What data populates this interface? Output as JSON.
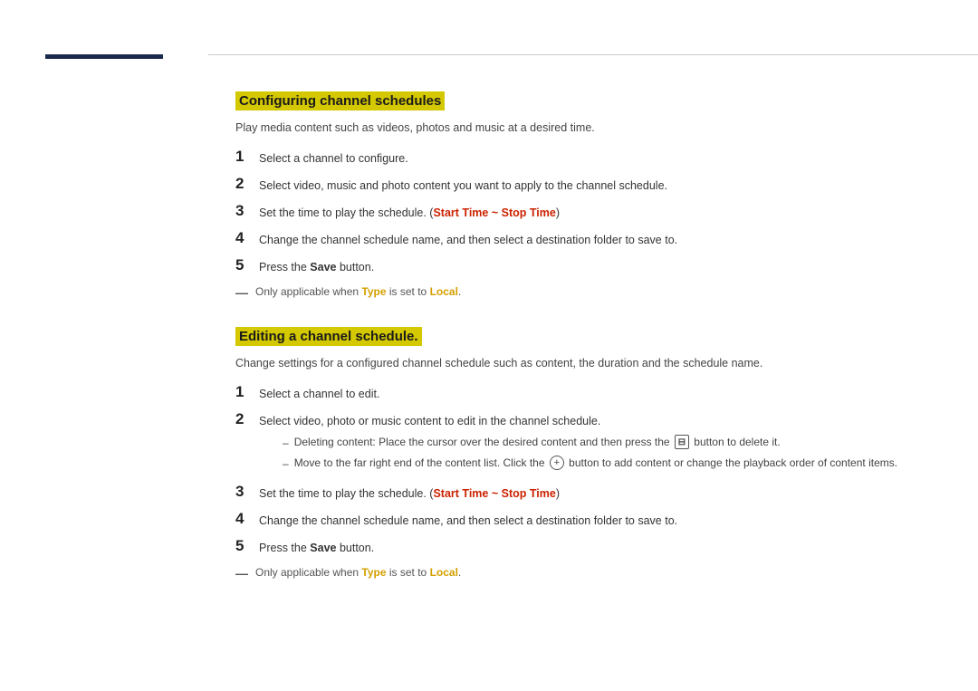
{
  "sidebar": {
    "bar": ""
  },
  "section1": {
    "title": "Configuring channel schedules",
    "subtitle": "Play media content such as videos, photos and music at a desired time.",
    "steps": [
      {
        "number": "1",
        "text": "Select a channel to configure."
      },
      {
        "number": "2",
        "text": "Select video, music and photo content you want to apply to the channel schedule."
      },
      {
        "number": "3",
        "text_before": "Set the time to play the schedule. (",
        "highlight": "Start Time ~ Stop Time",
        "text_after": ")"
      },
      {
        "number": "4",
        "text": "Change the channel schedule name, and then select a destination folder to save to."
      },
      {
        "number": "5",
        "text_before": "Press the ",
        "bold": "Save",
        "text_after": " button."
      }
    ],
    "note": "Only applicable when ",
    "note_bold": "Type",
    "note_mid": " is set to ",
    "note_end": "Local",
    "note_end_dot": "."
  },
  "section2": {
    "title": "Editing a channel schedule.",
    "subtitle": "Change settings for a configured channel schedule such as content, the duration and the schedule name.",
    "steps": [
      {
        "number": "1",
        "text": "Select a channel to edit."
      },
      {
        "number": "2",
        "text": "Select video, photo or music content to edit in the channel schedule."
      },
      {
        "number": "3",
        "text_before": "Set the time to play the schedule. (",
        "highlight": "Start Time ~ Stop Time",
        "text_after": ")"
      },
      {
        "number": "4",
        "text": "Change the channel schedule name, and then select a destination folder to save to."
      },
      {
        "number": "5",
        "text_before": "Press the ",
        "bold": "Save",
        "text_after": " button."
      }
    ],
    "sub_bullets": [
      {
        "text_before": "Deleting content: Place the cursor over the desired content and then press the ",
        "icon": "delete",
        "text_after": " button to delete it."
      },
      {
        "text_before": "Move to the far right end of the content list. Click the ",
        "icon": "plus",
        "text_after": " button to add content or change the playback order of content items."
      }
    ],
    "note": "Only applicable when ",
    "note_bold": "Type",
    "note_mid": " is set to ",
    "note_end": "Local",
    "note_end_dot": "."
  }
}
